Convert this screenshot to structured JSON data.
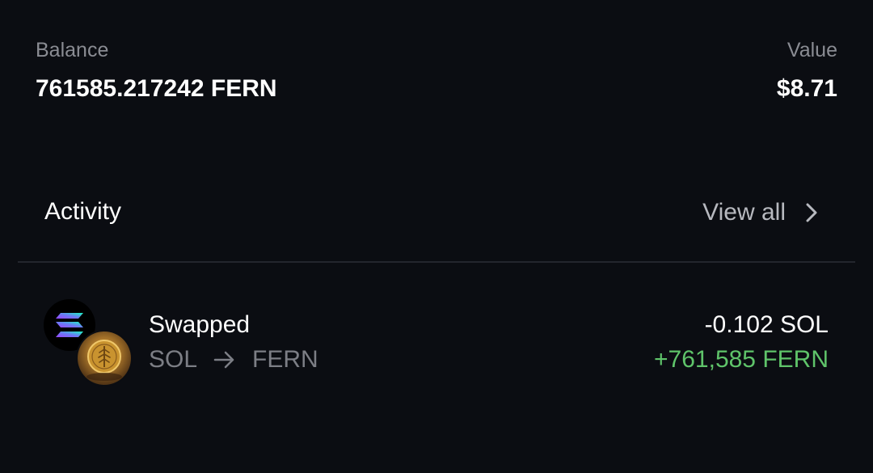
{
  "balance": {
    "label": "Balance",
    "value": "761585.217242 FERN"
  },
  "value_stat": {
    "label": "Value",
    "value": "$8.71"
  },
  "activity": {
    "title": "Activity",
    "view_all_label": "View all",
    "items": [
      {
        "title": "Swapped",
        "from_token": "SOL",
        "to_token": "FERN",
        "amount_out": "-0.102 SOL",
        "amount_in": "+761,585 FERN",
        "icons": [
          "solana-token-icon",
          "fern-token-icon"
        ]
      }
    ]
  },
  "colors": {
    "background": "#0b0d12",
    "muted_text": "#8a8c93",
    "positive": "#5fc46a",
    "divider": "#23262d"
  }
}
